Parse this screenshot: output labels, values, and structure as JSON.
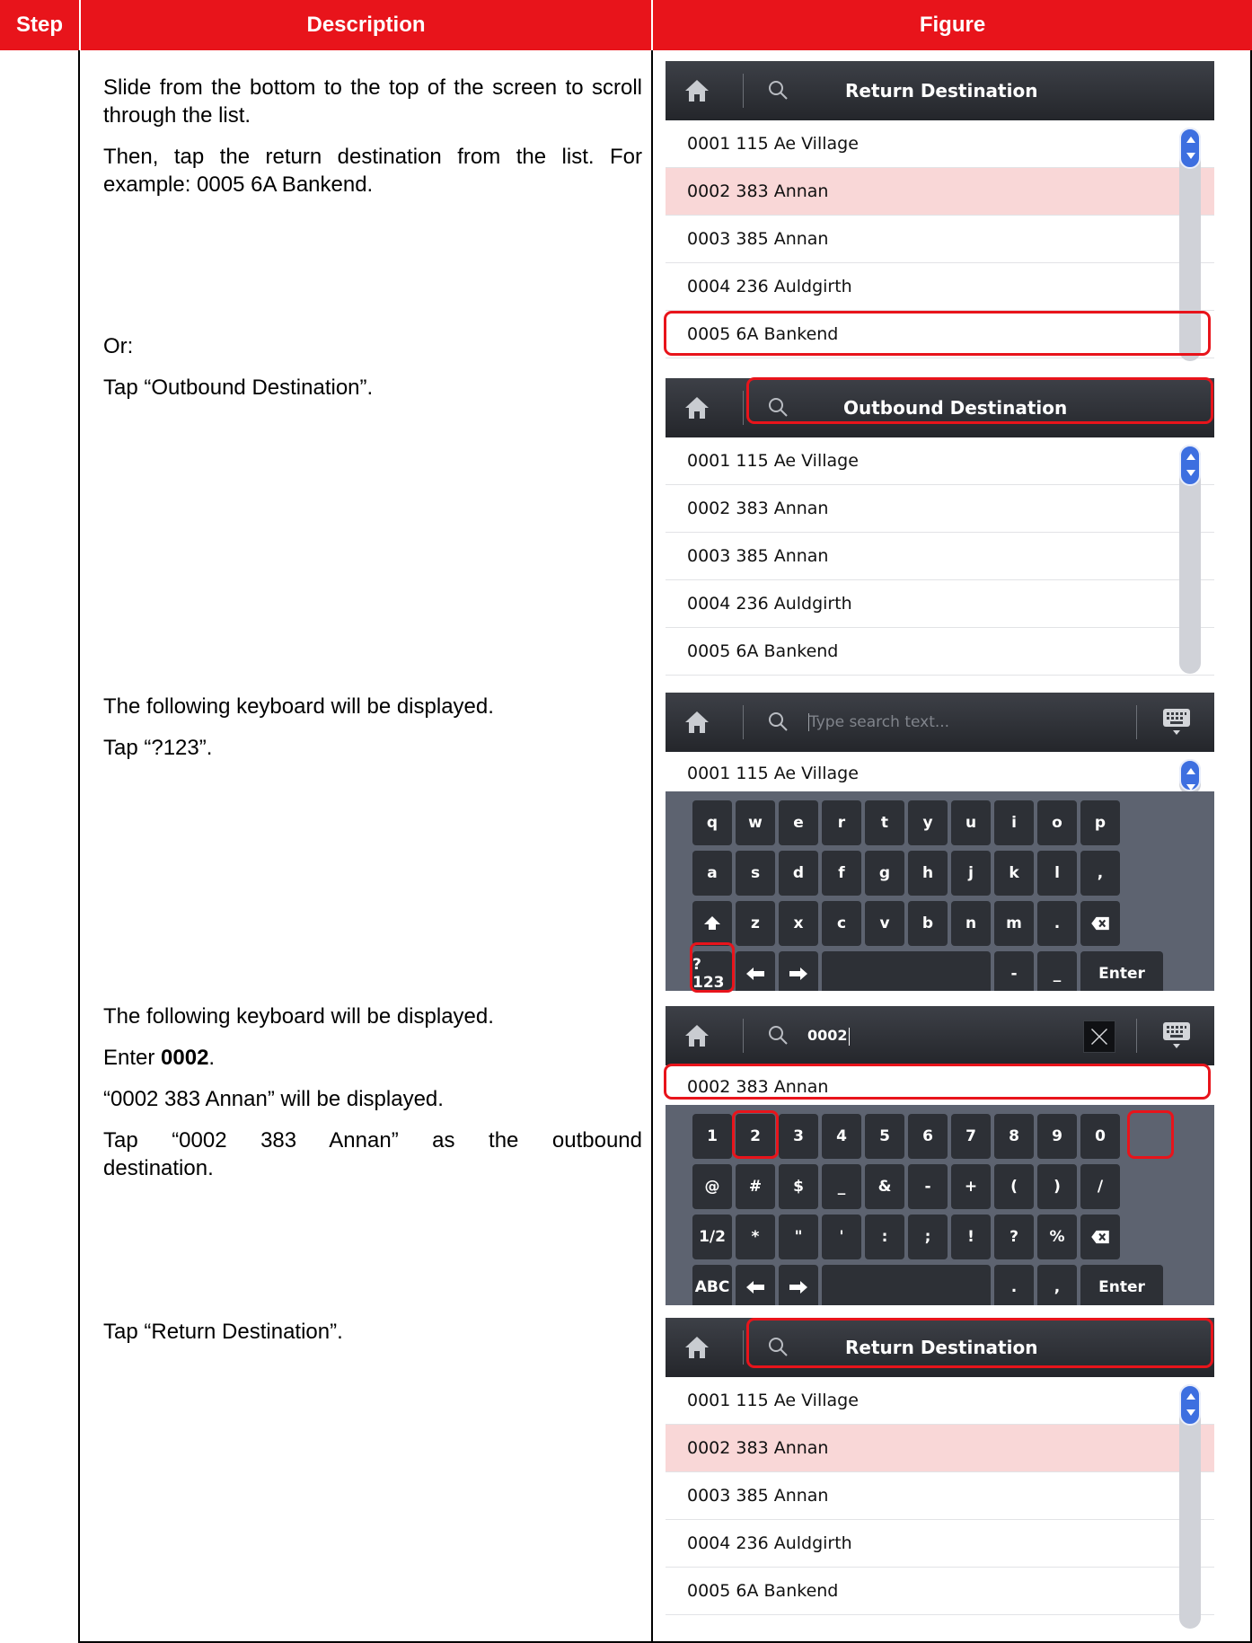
{
  "header": {
    "step": "Step",
    "description": "Description",
    "figure": "Figure"
  },
  "descriptions": {
    "block1": [
      "Slide from the bottom to the top of the screen to scroll through the list.",
      "Then, tap the return destination from the list. For example: 0005 6A Bankend."
    ],
    "block2": [
      "Or:",
      "Tap “Outbound Destination”."
    ],
    "block3": [
      "The following keyboard will be displayed.",
      "Tap “?123”."
    ],
    "block4": {
      "line1": "The following keyboard will be displayed.",
      "line2_prefix": "Enter ",
      "line2_bold": "0002",
      "line2_suffix": ".",
      "line3": "“0002 383 Annan” will be displayed.",
      "line4": "Tap “0002 383 Annan” as the outbound destination."
    },
    "block5": [
      "Tap “Return Destination”."
    ]
  },
  "colors": {
    "accent_red": "#e8141b",
    "selected_row": "#f9d7d7",
    "scroll_thumb": "#3d6fe0",
    "titlebar": "#2f3237",
    "keyboard_bg": "#5d6370",
    "key_bg": "#2d3036"
  },
  "icons": {
    "home": "home-icon",
    "search": "search-icon",
    "keyboard": "keyboard-icon",
    "close": "close-icon",
    "shift": "shift-icon",
    "backspace": "backspace-icon",
    "left": "arrow-left-icon",
    "right": "arrow-right-icon"
  },
  "screen1": {
    "title": "Return Destination",
    "rows": [
      "0001 115 Ae Village",
      "0002 383 Annan",
      "0003 385 Annan",
      "0004 236 Auldgirth",
      "0005 6A Bankend"
    ]
  },
  "screen2": {
    "title": "Outbound Destination",
    "rows": [
      "0001 115 Ae Village",
      "0002 383 Annan",
      "0003 385 Annan",
      "0004 236 Auldgirth",
      "0005 6A Bankend"
    ]
  },
  "screen3": {
    "placeholder": "Type search text...",
    "row": "0001 115 Ae Village",
    "keys": {
      "row1": [
        "q",
        "w",
        "e",
        "r",
        "t",
        "y",
        "u",
        "i",
        "o",
        "p"
      ],
      "row2": [
        "a",
        "s",
        "d",
        "f",
        "g",
        "h",
        "j",
        "k",
        "l",
        ","
      ],
      "row3": [
        "z",
        "x",
        "c",
        "v",
        "b",
        "n",
        "m",
        "."
      ],
      "mode": "?123",
      "dash": "-",
      "underscore": "_",
      "enter": "Enter"
    }
  },
  "screen4": {
    "search_value": "0002",
    "row": "0002 383 Annan",
    "keys": {
      "row1": [
        "1",
        "2",
        "3",
        "4",
        "5",
        "6",
        "7",
        "8",
        "9",
        "0"
      ],
      "row2": [
        "@",
        "#",
        "$",
        "_",
        "&",
        "-",
        "+",
        "(",
        ")",
        "/"
      ],
      "row3": [
        "*",
        "\"",
        "'",
        ":",
        ";",
        "!",
        "?",
        "%"
      ],
      "shift_mode": "1/2",
      "mode": "ABC",
      "dot": ".",
      "comma": ",",
      "enter": "Enter"
    }
  },
  "screen5": {
    "title": "Return Destination",
    "rows": [
      "0001 115 Ae Village",
      "0002 383 Annan",
      "0003 385 Annan",
      "0004 236 Auldgirth",
      "0005 6A Bankend"
    ]
  }
}
